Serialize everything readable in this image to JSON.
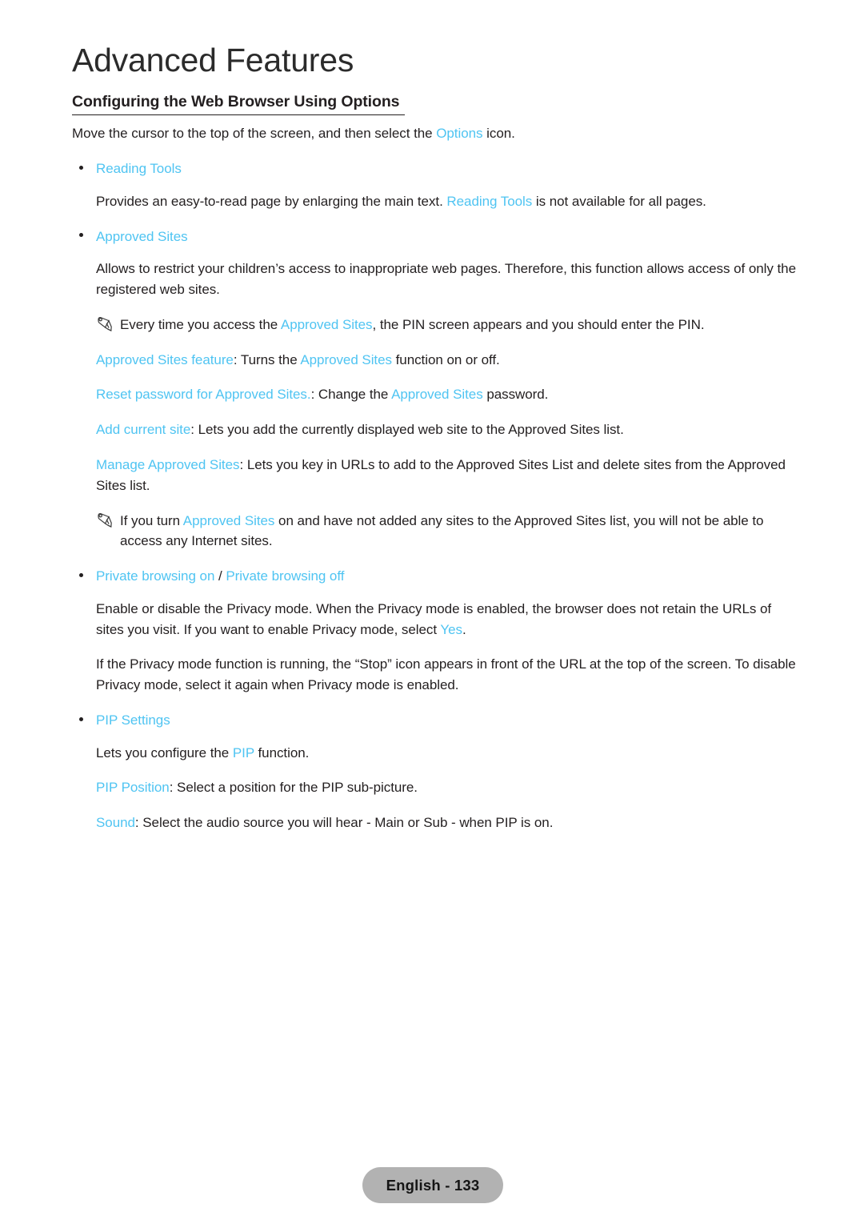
{
  "chapter": {
    "title": "Advanced Features"
  },
  "section": {
    "heading": "Configuring the Web Browser Using Options",
    "intro": {
      "pre": "Move the cursor to the top of the screen, and then select the ",
      "term": "Options",
      "post": " icon."
    }
  },
  "blocks": {
    "reading_tools": {
      "bullet_label": "Reading Tools",
      "body_pre": "Provides an easy-to-read page by enlarging the main text. ",
      "body_term": "Reading Tools",
      "body_post": " is not available for all pages."
    },
    "approved_sites": {
      "bullet_label": "Approved Sites",
      "body": "Allows to restrict your children’s access to inappropriate web pages. Therefore, this function allows access of only the registered web sites.",
      "note1_pre": "Every time you access the ",
      "note1_term": "Approved Sites",
      "note1_post": ", the PIN screen appears and you should enter the PIN.",
      "feature_term": "Approved Sites feature",
      "feature_mid": ": Turns the ",
      "feature_term2": "Approved Sites",
      "feature_post": " function on or off.",
      "reset_term": "Reset password for Approved Sites.",
      "reset_mid": ": Change the ",
      "reset_term2": "Approved Sites",
      "reset_post": " password.",
      "add_term": "Add current site",
      "add_post": ": Lets you add the currently displayed web site to the Approved Sites list.",
      "manage_term": "Manage Approved Sites",
      "manage_post": ": Lets you key in URLs to add to the Approved Sites List and delete sites from the Approved Sites list.",
      "note2_pre": "If you turn ",
      "note2_term": "Approved Sites",
      "note2_post": " on and have not added any sites to the Approved Sites list, you will not be able to access any Internet sites."
    },
    "private_browsing": {
      "bullet_term1": "Private browsing on",
      "bullet_sep": " / ",
      "bullet_term2": "Private browsing off",
      "body1_pre": "Enable or disable the Privacy mode. When the Privacy mode is enabled, the browser does not retain the URLs of sites you visit. If you want to enable Privacy mode, select ",
      "body1_term": "Yes",
      "body1_post": ".",
      "body2": "If the Privacy mode function is running, the “Stop” icon appears in front of the URL at the top of the screen. To disable Privacy mode, select it again when Privacy mode is enabled."
    },
    "pip_settings": {
      "bullet_label": "PIP Settings",
      "body_pre": "Lets you configure the ",
      "body_term": "PIP",
      "body_post": " function.",
      "position_term": "PIP Position",
      "position_post": ": Select a position for the PIP sub-picture.",
      "sound_term": "Sound",
      "sound_post": ": Select the audio source you will hear - Main or Sub - when PIP is on."
    }
  },
  "footer": {
    "page_label": "English - 133"
  },
  "colors": {
    "highlight": "#4fc4f2",
    "text": "#231f20",
    "footer_pill": "#b2b2b2"
  },
  "icons": {
    "note": "pencil-note-icon",
    "bullet": "bullet-dot-icon"
  }
}
